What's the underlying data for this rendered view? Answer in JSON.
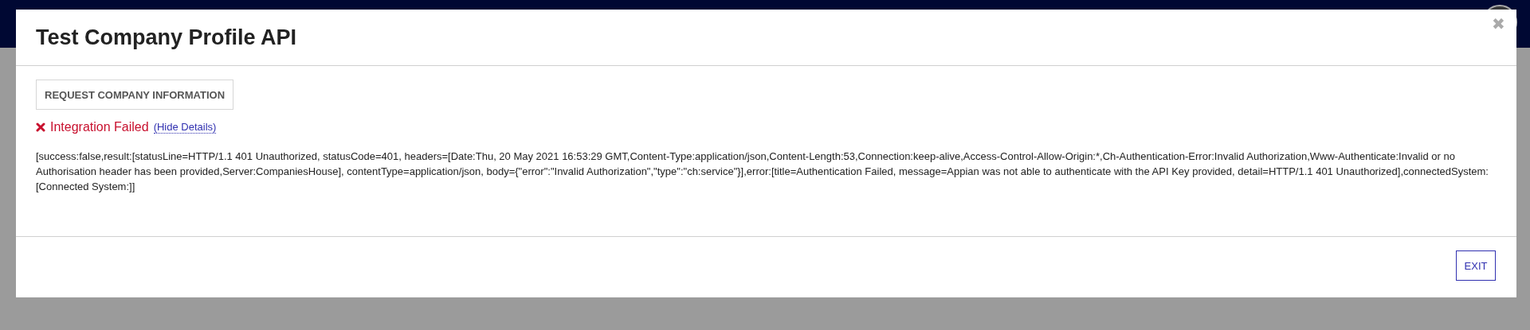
{
  "dialog": {
    "title": "Test Company Profile API",
    "close_icon": "✖"
  },
  "request_button": "REQUEST COMPANY INFORMATION",
  "status": {
    "failed": true,
    "label": "Integration Failed",
    "details_link": "(Hide Details)",
    "details": "[success:false,result:[statusLine=HTTP/1.1 401 Unauthorized, statusCode=401, headers=[Date:Thu, 20 May 2021 16:53:29 GMT,Content-Type:application/json,Content-Length:53,Connection:keep-alive,Access-Control-Allow-Origin:*,Ch-Authentication-Error:Invalid Authorization,Www-Authenticate:Invalid or no Authorisation header has been provided,Server:CompaniesHouse], contentType=application/json, body={\"error\":\"Invalid Authorization\",\"type\":\"ch:service\"}],error:[title=Authentication Failed, message=Appian was not able to authenticate with the API Key provided, detail=HTTP/1.1 401 Unauthorized],connectedSystem:[Connected System:]]"
  },
  "exit_button": "EXIT"
}
